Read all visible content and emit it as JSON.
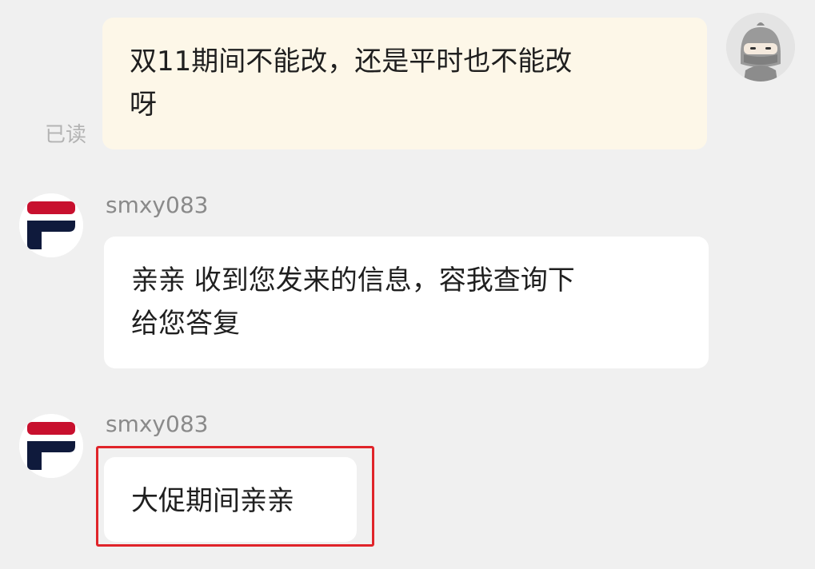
{
  "messages": [
    {
      "direction": "outgoing",
      "text": "双11期间不能改，还是平时也不能改\n呀",
      "status": "已读",
      "avatar": "ninja-avatar-icon"
    },
    {
      "direction": "incoming",
      "sender": "smxy083",
      "text": "亲亲 收到您发来的信息，容我查询下\n给您答复",
      "avatar": "fila-logo-icon"
    },
    {
      "direction": "incoming",
      "sender": "smxy083",
      "text": "大促期间亲亲",
      "avatar": "fila-logo-icon",
      "highlighted": true
    }
  ],
  "colors": {
    "background": "#f0f0f0",
    "outgoing_bubble": "#fdf7e8",
    "incoming_bubble": "#ffffff",
    "highlight_border": "#e0242a",
    "fila_navy": "#0f1a3c",
    "fila_red": "#c8102e"
  }
}
